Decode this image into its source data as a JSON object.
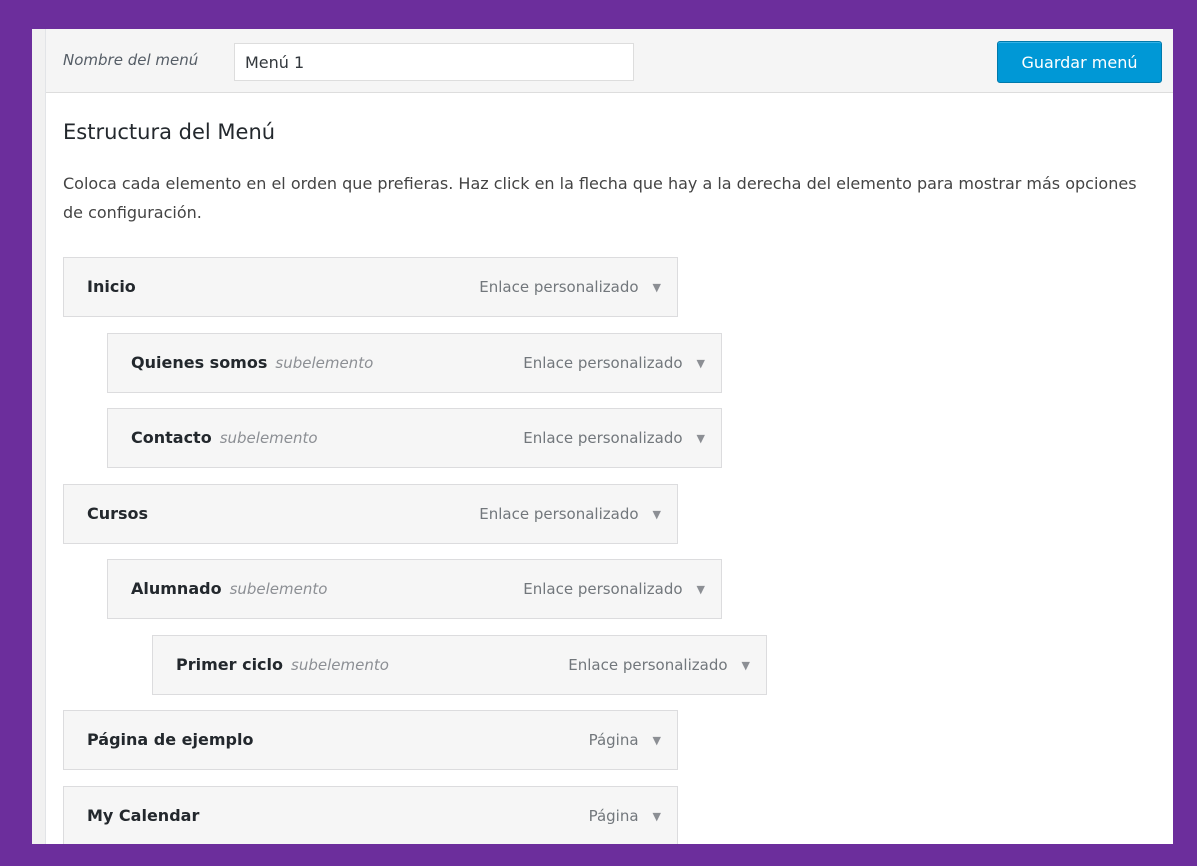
{
  "header": {
    "menu_name_label": "Nombre del menú",
    "menu_name_value": "Menú 1",
    "save_button_label": "Guardar menú"
  },
  "structure": {
    "title": "Estructura del Menú",
    "instructions": "Coloca cada elemento en el orden que prefieras. Haz click en la flecha que hay a la derecha del elemento para mostrar más opciones de configuración."
  },
  "menu_items": [
    {
      "title": "Inicio",
      "sublabel": "",
      "type": "Enlace personalizado",
      "depth": 0,
      "arrow": "▼"
    },
    {
      "title": "Quienes somos",
      "sublabel": "subelemento",
      "type": "Enlace personalizado",
      "depth": 1,
      "arrow": "▼"
    },
    {
      "title": "Contacto",
      "sublabel": "subelemento",
      "type": "Enlace personalizado",
      "depth": 1,
      "arrow": "▼"
    },
    {
      "title": "Cursos",
      "sublabel": "",
      "type": "Enlace personalizado",
      "depth": 0,
      "arrow": "▼"
    },
    {
      "title": "Alumnado",
      "sublabel": "subelemento",
      "type": "Enlace personalizado",
      "depth": 1,
      "arrow": "▼"
    },
    {
      "title": "Primer ciclo",
      "sublabel": "subelemento",
      "type": "Enlace personalizado",
      "depth": 2,
      "arrow": "▼"
    },
    {
      "title": "Página de ejemplo",
      "sublabel": "",
      "type": "Página",
      "depth": 0,
      "arrow": "▼"
    },
    {
      "title": "My Calendar",
      "sublabel": "",
      "type": "Página",
      "depth": 0,
      "arrow": "▼"
    }
  ],
  "colors": {
    "frame_border": "#6c2e9c",
    "primary_button": "#0098d6"
  },
  "icons": {
    "expand_arrow": "triangle-down-icon"
  }
}
